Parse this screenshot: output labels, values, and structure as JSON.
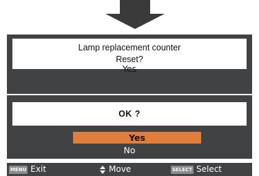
{
  "dialog1": {
    "line1": "Lamp replacement counter",
    "line2": "Reset?",
    "option_yes": "Yes"
  },
  "dialog2": {
    "prompt": "OK ?",
    "option_yes": "Yes",
    "option_no": "No",
    "selected": "Yes"
  },
  "footer": {
    "menu_key": "MENU",
    "exit_label": "Exit",
    "move_label": "Move",
    "select_key": "SELECT",
    "select_label": "Select"
  },
  "colors": {
    "panel": "#414244",
    "highlight": "#e07f3c",
    "arrow": "#3a3a3a"
  }
}
